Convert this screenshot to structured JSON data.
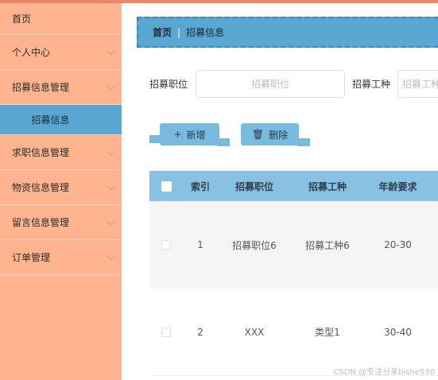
{
  "sidebar": {
    "items": [
      {
        "label": "首页"
      },
      {
        "label": "个人中心"
      },
      {
        "label": "招募信息管理"
      },
      {
        "label": "求职信息管理"
      },
      {
        "label": "物资信息管理"
      },
      {
        "label": "留言信息管理"
      },
      {
        "label": "订单管理"
      }
    ],
    "active_subitem": "招募信息"
  },
  "breadcrumb": {
    "home": "首页",
    "separator": "|",
    "current": "招募信息"
  },
  "search": {
    "position_label": "招募职位",
    "position_placeholder": "招募职位",
    "type_label": "招募工种",
    "type_placeholder": "招募工种"
  },
  "actions": {
    "add_label": "新增",
    "delete_label": "删除",
    "add_icon": "+",
    "delete_icon": "🗑"
  },
  "table": {
    "headers": [
      "索引",
      "招募职位",
      "招募工种",
      "年龄要求"
    ],
    "rows": [
      {
        "index": "1",
        "position": "招募职位6",
        "type": "招募工种6",
        "age": "20-30"
      },
      {
        "index": "2",
        "position": "XXX",
        "type": "类型1",
        "age": "30-40"
      }
    ]
  },
  "watermark": "CSDN @专注分享bishe530",
  "colors": {
    "sidebar": "#ffb490",
    "accent": "#5aa6d2",
    "table_header": "#88c2e3"
  }
}
